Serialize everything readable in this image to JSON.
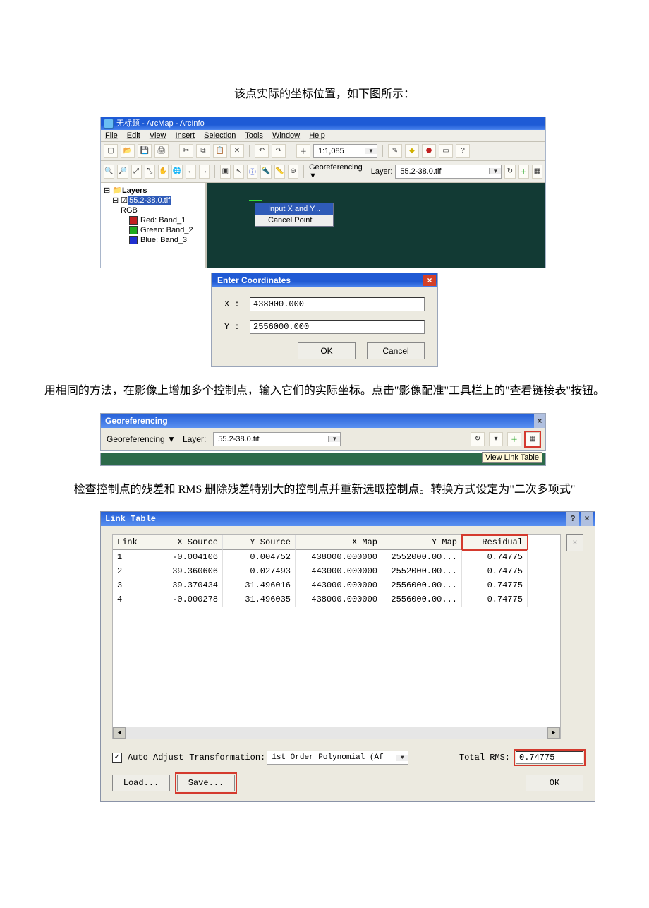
{
  "paragraphs": {
    "p1": "该点实际的坐标位置，如下图所示：",
    "p2": "用相同的方法，在影像上增加多个控制点，输入它们的实际坐标。点击\"影像配准\"工具栏上的\"查看链接表\"按钮。",
    "p3": "检查控制点的残差和 RMS 删除残差特别大的控制点并重新选取控制点。转换方式设定为\"二次多项式\""
  },
  "arcmap": {
    "title": "无标题 - ArcMap - ArcInfo",
    "menus": [
      "File",
      "Edit",
      "View",
      "Insert",
      "Selection",
      "Tools",
      "Window",
      "Help"
    ],
    "scale_combo": "1:1,085",
    "georef_label": "Georeferencing ▼",
    "layer_label": "Layer:",
    "layer_combo": "55.2-38.0.tif",
    "toc": {
      "title": "Layers",
      "layer_selected": "55.2-38.0.tif",
      "rgb": "RGB",
      "bands": [
        "Red:   Band_1",
        "Green: Band_2",
        "Blue:  Band_3"
      ]
    },
    "ctxmenu": {
      "item1": "Input X and Y...",
      "item2": "Cancel Point"
    }
  },
  "entercoord": {
    "title": "Enter Coordinates",
    "x_label": "X :",
    "y_label": "Y :",
    "x_value": "438000.000",
    "y_value": "2556000.000",
    "ok": "OK",
    "cancel": "Cancel"
  },
  "georef_toolbar": {
    "title": "Georeferencing",
    "menu_label": "Georeferencing ▼",
    "layer_label": "Layer:",
    "layer_combo": "55.2-38.0.tif",
    "tooltip": "View Link Table"
  },
  "link_table": {
    "title": "Link Table",
    "columns": [
      "Link",
      "X Source",
      "Y Source",
      "X Map",
      "Y Map",
      "Residual"
    ],
    "rows": [
      {
        "link": "1",
        "xs": "-0.004106",
        "ys": "0.004752",
        "xm": "438000.000000",
        "ym": "2552000.00...",
        "res": "0.74775"
      },
      {
        "link": "2",
        "xs": "39.360606",
        "ys": "0.027493",
        "xm": "443000.000000",
        "ym": "2552000.00...",
        "res": "0.74775"
      },
      {
        "link": "3",
        "xs": "39.370434",
        "ys": "31.496016",
        "xm": "443000.000000",
        "ym": "2556000.00...",
        "res": "0.74775"
      },
      {
        "link": "4",
        "xs": "-0.000278",
        "ys": "31.496035",
        "xm": "438000.000000",
        "ym": "2556000.00...",
        "res": "0.74775"
      }
    ],
    "auto_adjust_label": "Auto Adjust",
    "transformation_label": "Transformation:",
    "transformation_value": "1st Order Polynomial (Af",
    "total_rms_label": "Total RMS:",
    "total_rms_value": "0.74775",
    "load_btn": "Load...",
    "save_btn": "Save...",
    "ok_btn": "OK",
    "delete_btn": "×"
  }
}
